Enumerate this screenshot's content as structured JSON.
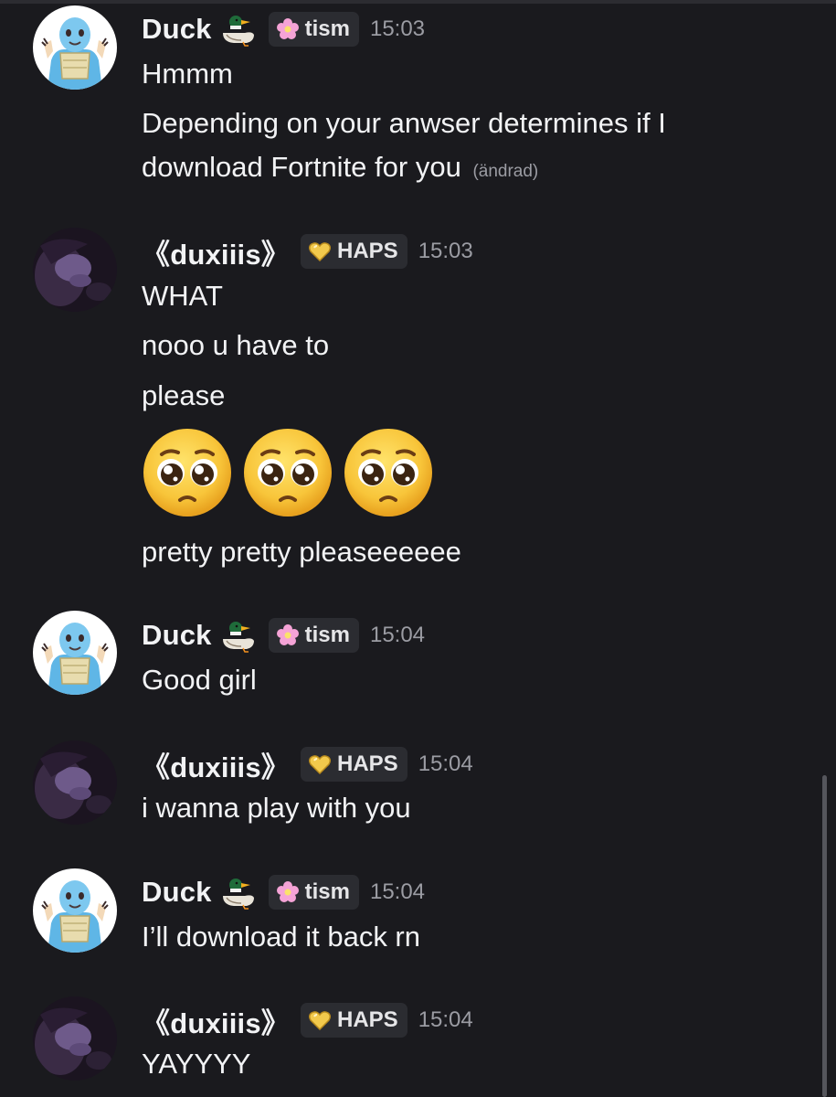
{
  "users": {
    "duck": {
      "name": "Duck",
      "badge": "duck-emoji",
      "tag": "tism",
      "tag_icon": "pink-flower-icon",
      "tag_color": "#f5a3d6"
    },
    "duxiiis": {
      "name": "《duxiiis》",
      "tag": "HAPS",
      "tag_icon": "gold-heart-icon",
      "tag_color": "#f2c94c"
    }
  },
  "messages": [
    {
      "author": "Duck",
      "time": "15:03",
      "lines": [
        "Hmmm",
        "Depending on your anwser determines if I",
        "download Fortnite for you"
      ],
      "edited_label": "(ändrad)"
    },
    {
      "author": "《duxiiis》",
      "time": "15:03",
      "lines": [
        "WHAT",
        "nooo u have to",
        "please",
        "pretty pretty pleaseeeeee"
      ],
      "emoji": [
        "pleading-face-icon",
        "pleading-face-icon",
        "pleading-face-icon"
      ]
    },
    {
      "author": "Duck",
      "time": "15:04",
      "lines": [
        "Good girl"
      ]
    },
    {
      "author": "《duxiiis》",
      "time": "15:04",
      "lines": [
        "i wanna play with you"
      ]
    },
    {
      "author": "Duck",
      "time": "15:04",
      "lines": [
        "I’ll download it back rn"
      ]
    },
    {
      "author": "《duxiiis》",
      "time": "15:04",
      "lines": [
        "YAYYYY"
      ]
    }
  ],
  "colors": {
    "background": "#1a1a1e",
    "text": "#f2f3f5",
    "muted": "#9b9ca3",
    "tag_bg": "#2b2c31"
  }
}
